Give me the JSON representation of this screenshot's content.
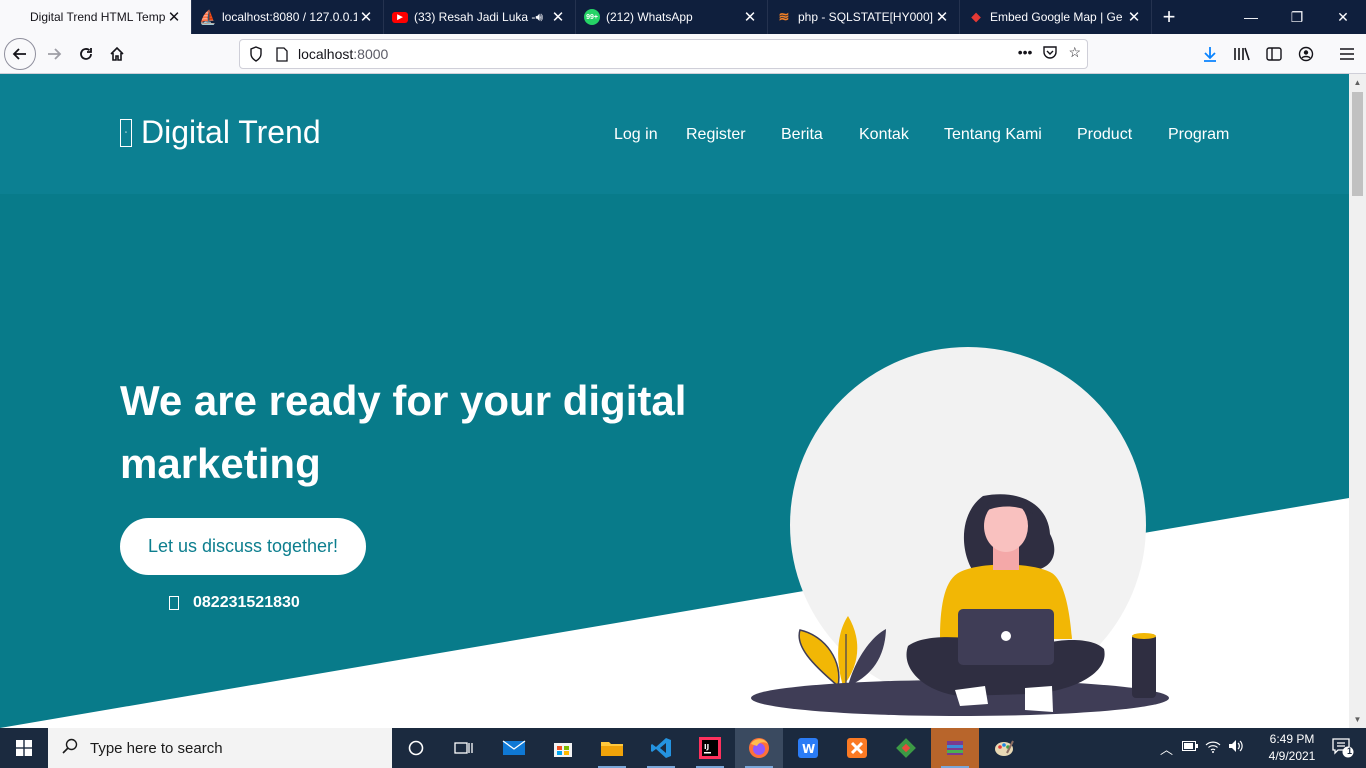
{
  "browser": {
    "tabs": [
      {
        "title": "Digital Trend HTML Template",
        "favicon": "page-icon",
        "active": true
      },
      {
        "title": "localhost:8080 / 127.0.0.1",
        "favicon": "phpmyadmin-icon"
      },
      {
        "title": "(33) Resah Jadi Luka -",
        "favicon": "youtube-icon",
        "audio": true
      },
      {
        "title": "(212) WhatsApp",
        "favicon": "whatsapp-icon"
      },
      {
        "title": "php - SQLSTATE[HY000]:",
        "favicon": "stackoverflow-icon"
      },
      {
        "title": "Embed Google Map | Ge",
        "favicon": "map-icon"
      }
    ],
    "url_host": "localhost",
    "url_port": ":8000"
  },
  "site": {
    "brand": "Digital Trend",
    "menu": [
      "Log in",
      "Register",
      "Berita",
      "Kontak",
      "Tentang Kami",
      "Product",
      "Program"
    ],
    "hero_title": "We are ready for your digital marketing",
    "cta_label": "Let us discuss together!",
    "phone": "082231521830"
  },
  "taskbar": {
    "search_placeholder": "Type here to search",
    "time": "6:49 PM",
    "date": "4/9/2021",
    "notification_count": "1"
  },
  "colors": {
    "hero_bg": "#087b8a",
    "header_bg": "#0c8092",
    "accent_yellow": "#f2b705",
    "dark_purple": "#3f3d56"
  }
}
